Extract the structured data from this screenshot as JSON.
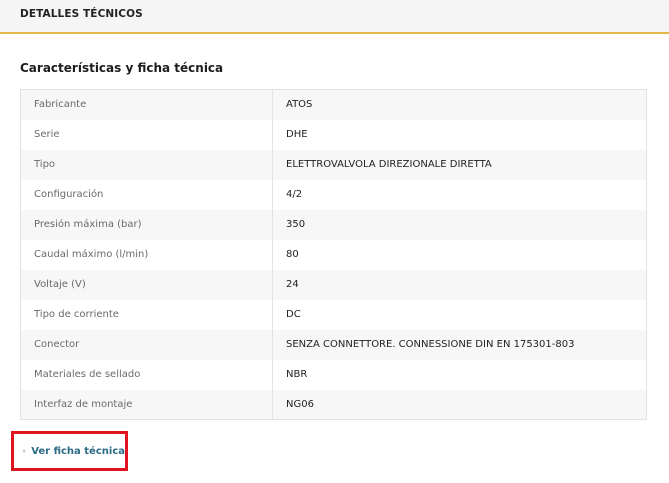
{
  "tab": {
    "title": "DETALLES TÉCNICOS"
  },
  "section": {
    "title": "Características y ficha técnica"
  },
  "specs": [
    {
      "label": "Fabricante",
      "value": "ATOS"
    },
    {
      "label": "Serie",
      "value": "DHE"
    },
    {
      "label": "Tipo",
      "value": "ELETTROVALVOLA DIREZIONALE DIRETTA"
    },
    {
      "label": "Configuración",
      "value": "4/2"
    },
    {
      "label": "Presión máxima (bar)",
      "value": "350"
    },
    {
      "label": "Caudal máximo (l/min)",
      "value": "80"
    },
    {
      "label": "Voltaje (V)",
      "value": "24"
    },
    {
      "label": "Tipo de corriente",
      "value": "DC"
    },
    {
      "label": "Conector",
      "value": "SENZA CONNETTORE. CONNESSIONE DIN EN 175301-803"
    },
    {
      "label": "Materiales de sellado",
      "value": "NBR"
    },
    {
      "label": "Interfaz de montaje",
      "value": "NG06"
    }
  ],
  "datasheet_link": {
    "label": "Ver ficha técnica",
    "icon": "document-icon"
  },
  "colors": {
    "accent_border": "#e6b84a",
    "link": "#2a6a86",
    "highlight": "#e0141e"
  }
}
